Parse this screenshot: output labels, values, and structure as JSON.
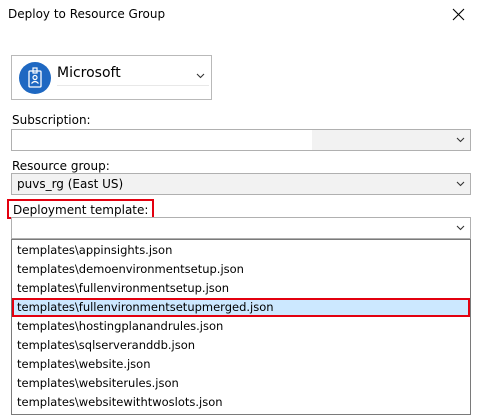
{
  "window": {
    "title": "Deploy to Resource Group"
  },
  "account": {
    "name": "Microsoft",
    "icon": "badge-icon"
  },
  "subscription": {
    "label": "Subscription:",
    "value": ""
  },
  "resource_group": {
    "label": "Resource group:",
    "value": "puvs_rg (East US)"
  },
  "deployment_template": {
    "label": "Deployment template:",
    "value": "",
    "options": [
      "templates\\appinsights.json",
      "templates\\demoenvironmentsetup.json",
      "templates\\fullenvironmentsetup.json",
      "templates\\fullenvironmentsetupmerged.json",
      "templates\\hostingplanandrules.json",
      "templates\\sqlserveranddb.json",
      "templates\\website.json",
      "templates\\websiterules.json",
      "templates\\websitewithtwoslots.json"
    ],
    "highlighted_option": "templates\\fullenvironmentsetupmerged.json"
  },
  "colors": {
    "highlight_border": "#e3000f",
    "selection_background": "#cce8ff",
    "avatar_background": "#1e68c2"
  }
}
